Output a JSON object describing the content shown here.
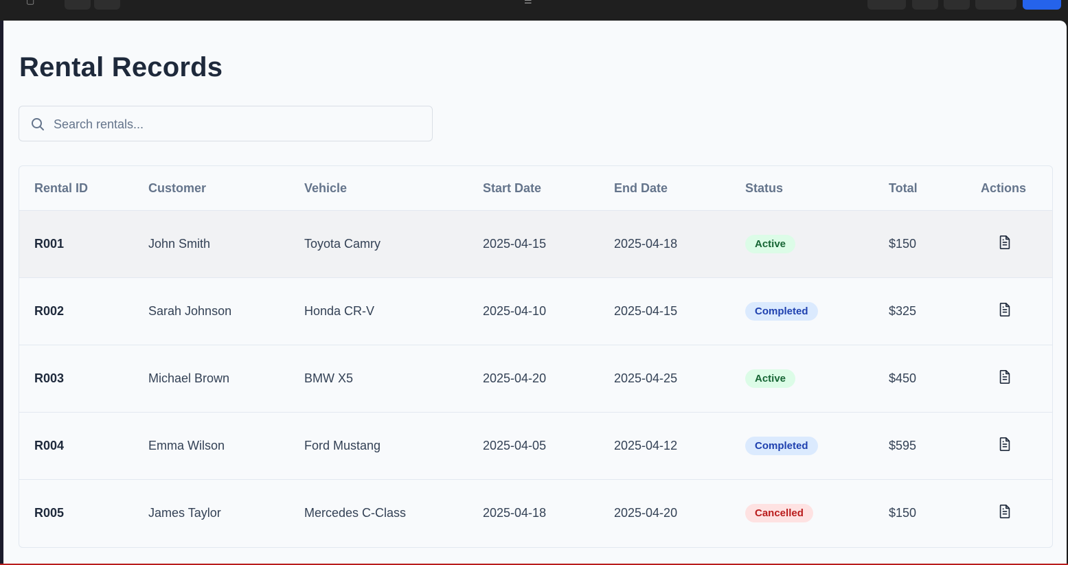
{
  "page": {
    "title": "Rental Records"
  },
  "search": {
    "placeholder": "Search rentals..."
  },
  "table": {
    "headers": [
      "Rental ID",
      "Customer",
      "Vehicle",
      "Start Date",
      "End Date",
      "Status",
      "Total",
      "Actions"
    ],
    "rows": [
      {
        "id": "R001",
        "customer": "John Smith",
        "vehicle": "Toyota Camry",
        "start": "2025-04-15",
        "end": "2025-04-18",
        "status": "Active",
        "status_kind": "active",
        "total": "$150",
        "action_icon": "document-icon"
      },
      {
        "id": "R002",
        "customer": "Sarah Johnson",
        "vehicle": "Honda CR-V",
        "start": "2025-04-10",
        "end": "2025-04-15",
        "status": "Completed",
        "status_kind": "completed",
        "total": "$325",
        "action_icon": "document-icon"
      },
      {
        "id": "R003",
        "customer": "Michael Brown",
        "vehicle": "BMW X5",
        "start": "2025-04-20",
        "end": "2025-04-25",
        "status": "Active",
        "status_kind": "active",
        "total": "$450",
        "action_icon": "document-icon"
      },
      {
        "id": "R004",
        "customer": "Emma Wilson",
        "vehicle": "Ford Mustang",
        "start": "2025-04-05",
        "end": "2025-04-12",
        "status": "Completed",
        "status_kind": "completed",
        "total": "$595",
        "action_icon": "document-icon"
      },
      {
        "id": "R005",
        "customer": "James Taylor",
        "vehicle": "Mercedes C-Class",
        "start": "2025-04-18",
        "end": "2025-04-20",
        "status": "Cancelled",
        "status_kind": "cancelled",
        "total": "$150",
        "action_icon": "document-icon"
      }
    ]
  },
  "colors": {
    "active_bg": "#dcfce7",
    "active_text": "#166534",
    "completed_bg": "#dbeafe",
    "completed_text": "#1e40af",
    "cancelled_bg": "#fee2e2",
    "cancelled_text": "#b91c1c",
    "title": "#1e293b",
    "header_text": "#64748b",
    "primary": "#2563eb"
  }
}
